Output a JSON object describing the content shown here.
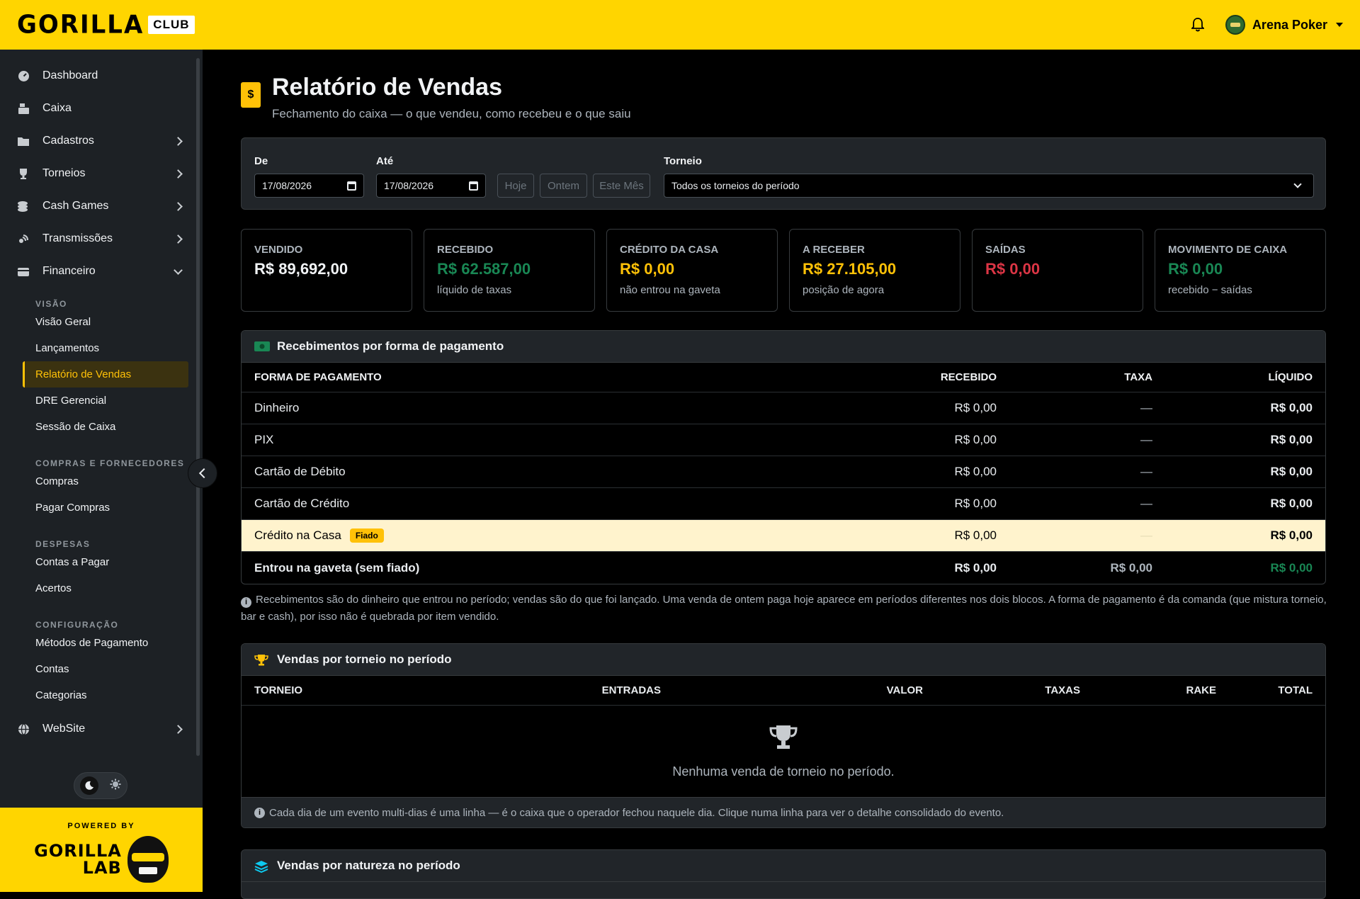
{
  "brand": {
    "word": "GORILLA",
    "club": "CLUB"
  },
  "user": {
    "name": "Arena Poker"
  },
  "sidebar": {
    "items": [
      {
        "label": "Dashboard",
        "icon": "dashboard-icon"
      },
      {
        "label": "Caixa",
        "icon": "cash-register-icon"
      },
      {
        "label": "Cadastros",
        "icon": "folder-icon"
      },
      {
        "label": "Torneios",
        "icon": "trophy-icon"
      },
      {
        "label": "Cash Games",
        "icon": "coins-icon"
      },
      {
        "label": "Transmissões",
        "icon": "broadcast-icon"
      },
      {
        "label": "Financeiro",
        "icon": "wallet-icon"
      }
    ],
    "sections": {
      "visao": "VISÃO",
      "compras": "COMPRAS E FORNECEDORES",
      "despesas": "DESPESAS",
      "config": "CONFIGURAÇÃO"
    },
    "sub": {
      "visao_geral": "Visão Geral",
      "lancamentos": "Lançamentos",
      "relatorio": "Relatório de Vendas",
      "dre": "DRE Gerencial",
      "sessao": "Sessão de Caixa",
      "compras": "Compras",
      "pagar_compras": "Pagar Compras",
      "contas_pagar": "Contas a Pagar",
      "acertos": "Acertos",
      "metodos": "Métodos de Pagamento",
      "contas": "Contas",
      "categorias": "Categorias"
    },
    "website": "WebSite",
    "powered_by": "POWERED BY",
    "lab_word_1": "GORILLA",
    "lab_word_2": "LAB"
  },
  "page": {
    "title": "Relatório de Vendas",
    "subtitle": "Fechamento do caixa — o que vendeu, como recebeu e o que saiu",
    "icon_glyph": "$"
  },
  "filters": {
    "de_label": "De",
    "de_value": "17/08/2026",
    "ate_label": "Até",
    "ate_value": "17/08/2026",
    "hoje": "Hoje",
    "ontem": "Ontem",
    "este_mes": "Este Mês",
    "torneio_label": "Torneio",
    "torneio_value": "Todos os torneios do período"
  },
  "stats": [
    {
      "label": "VENDIDO",
      "value": "R$ 89,692,00",
      "note": "",
      "color": "#f1f3f5"
    },
    {
      "label": "RECEBIDO",
      "value": "R$ 62.587,00",
      "note": "líquido de taxas",
      "color": "#198754"
    },
    {
      "label": "CRÉDITO DA CASA",
      "value": "R$ 0,00",
      "note": "não entrou na gaveta",
      "color": "#ffc107"
    },
    {
      "label": "A RECEBER",
      "value": "R$ 27.105,00",
      "note": "posição de agora",
      "color": "#ffc107"
    },
    {
      "label": "SAÍDAS",
      "value": "R$ 0,00",
      "note": "",
      "color": "#dc3545"
    },
    {
      "label": "MOVIMENTO DE CAIXA",
      "value": "R$ 0,00",
      "note": "recebido − saídas",
      "color": "#198754"
    }
  ],
  "payments": {
    "title": "Recebimentos por forma de pagamento",
    "headers": {
      "forma": "FORMA DE PAGAMENTO",
      "recebido": "RECEBIDO",
      "taxa": "TAXA",
      "liquido": "LÍQUIDO"
    },
    "rows": [
      {
        "forma": "Dinheiro",
        "recebido": "R$ 0,00",
        "taxa": "—",
        "liquido": "R$ 0,00"
      },
      {
        "forma": "PIX",
        "recebido": "R$ 0,00",
        "taxa": "—",
        "liquido": "R$ 0,00"
      },
      {
        "forma": "Cartão de Débito",
        "recebido": "R$ 0,00",
        "taxa": "—",
        "liquido": "R$ 0,00"
      },
      {
        "forma": "Cartão de Crédito",
        "recebido": "R$ 0,00",
        "taxa": "—",
        "liquido": "R$ 0,00"
      }
    ],
    "fiado_row": {
      "forma": "Crédito na Casa",
      "badge": "Fiado",
      "recebido": "R$ 0,00",
      "taxa": "—",
      "liquido": "R$ 0,00"
    },
    "total_row": {
      "forma": "Entrou na gaveta (sem fiado)",
      "recebido": "R$ 0,00",
      "taxa": "R$ 0,00",
      "liquido": "R$ 0,00"
    },
    "note": "Recebimentos são do dinheiro que entrou no período; vendas são do que foi lançado. Uma venda de ontem paga hoje aparece em períodos diferentes nos dois blocos. A forma de pagamento é da comanda (que mistura torneio, bar e cash), por isso não é quebrada por item vendido."
  },
  "tournaments": {
    "title": "Vendas por torneio no período",
    "headers": {
      "torneio": "TORNEIO",
      "entradas": "ENTRADAS",
      "valor": "VALOR",
      "taxas": "TAXAS",
      "rake": "RAKE",
      "total": "TOTAL"
    },
    "empty": "Nenhuma venda de torneio no período.",
    "foot": "Cada dia de um evento multi-dias é uma linha — é o caixa que o operador fechou naquele dia. Clique numa linha para ver o detalhe consolidado do evento."
  },
  "natureza": {
    "title": "Vendas por natureza no período"
  }
}
